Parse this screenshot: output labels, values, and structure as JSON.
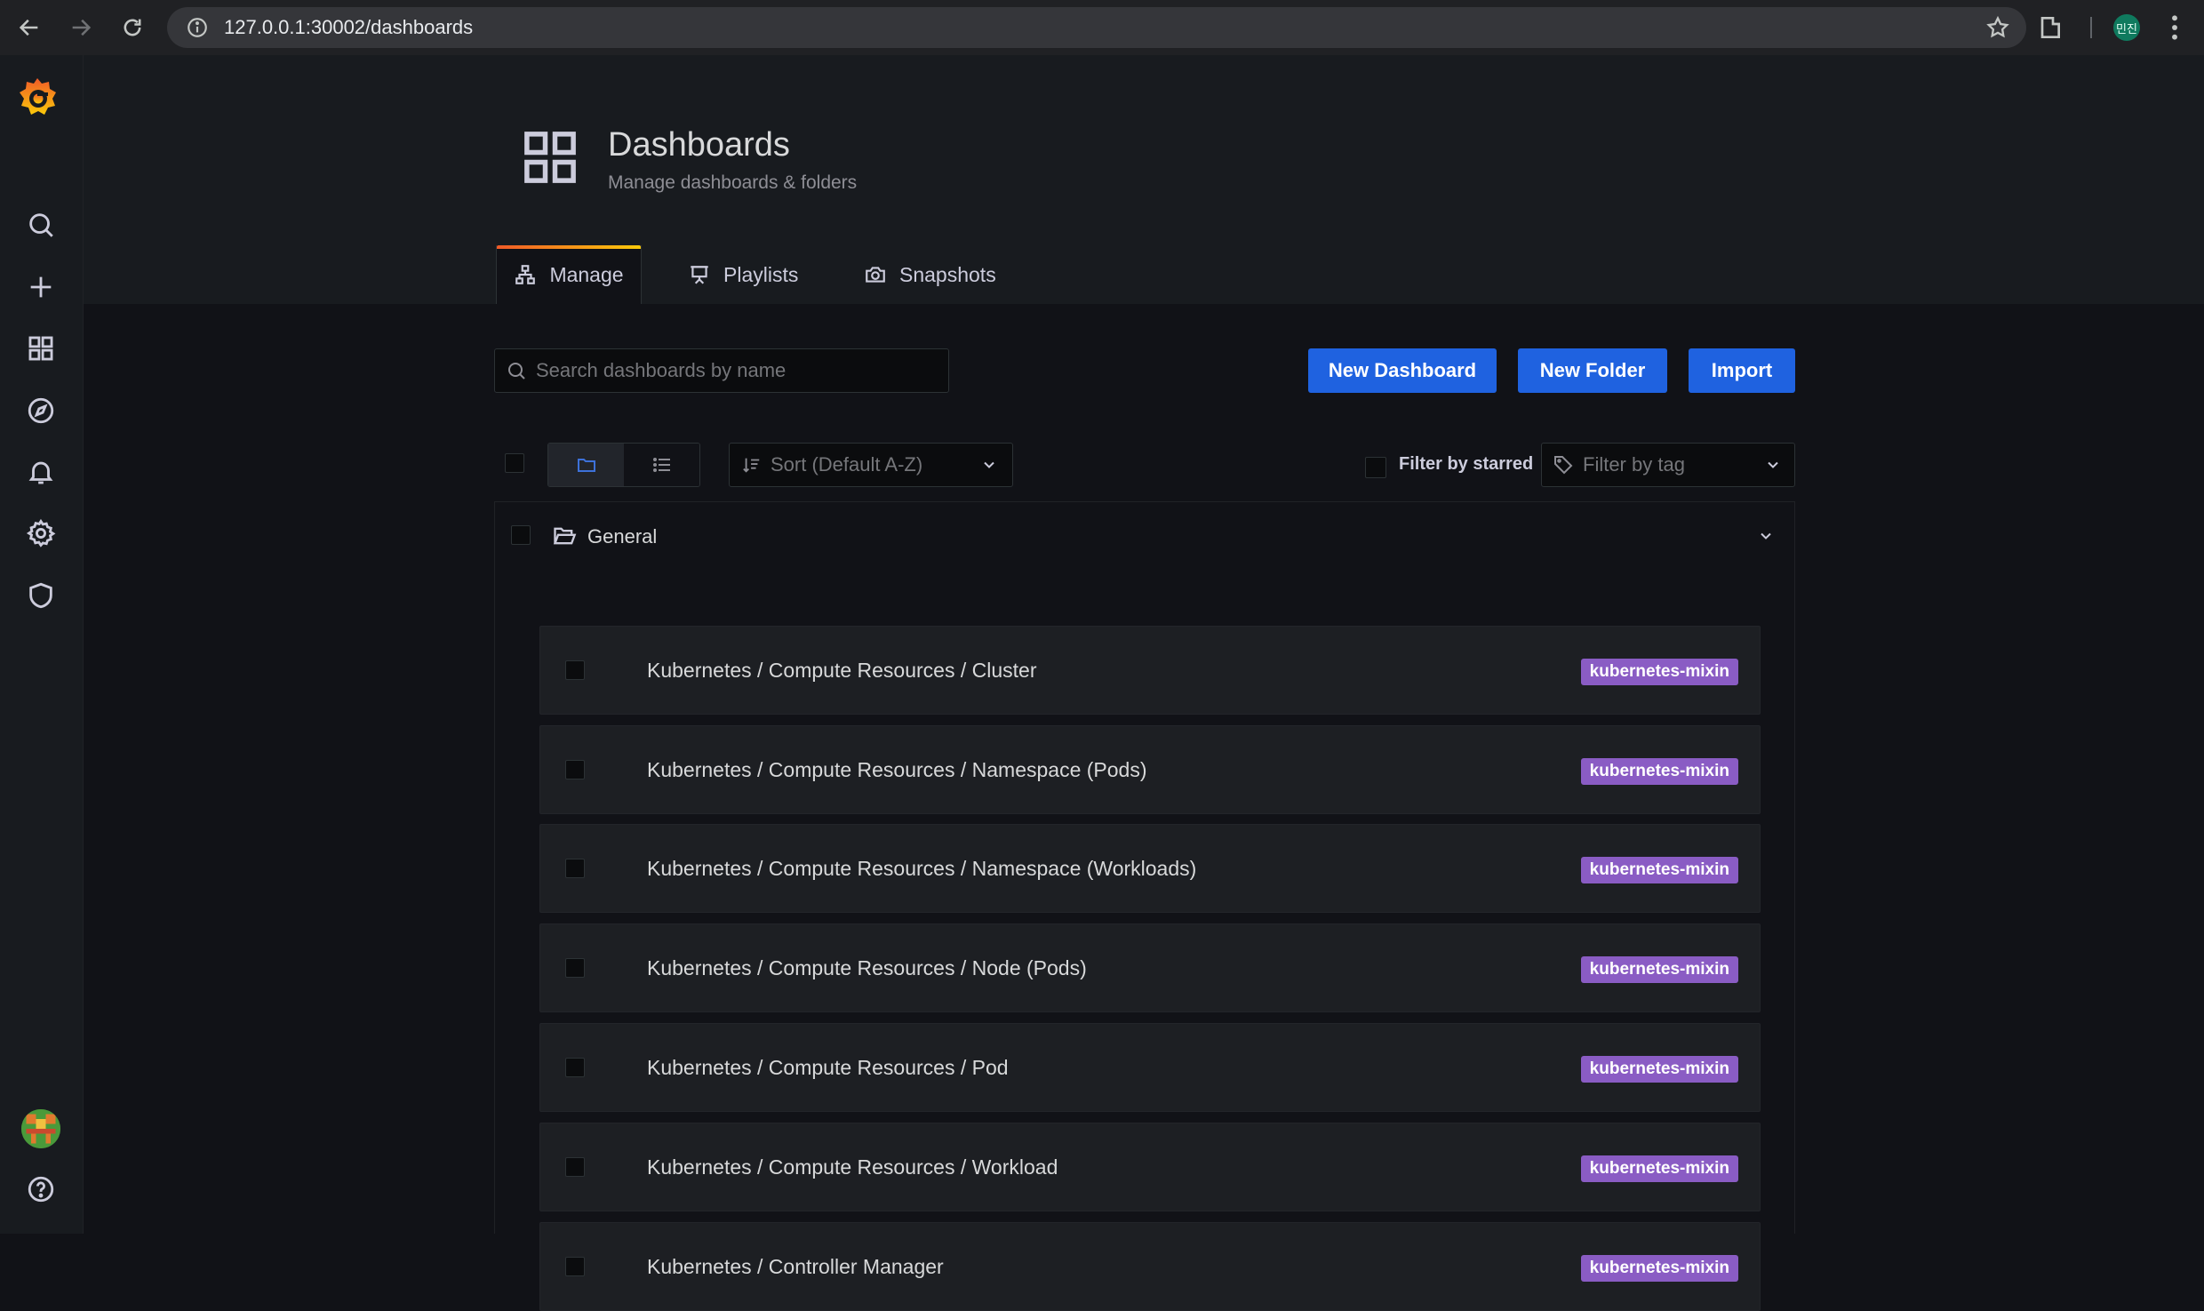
{
  "browser": {
    "url": "127.0.0.1:30002/dashboards",
    "profile_initials": "민진"
  },
  "page": {
    "title": "Dashboards",
    "subtitle": "Manage dashboards & folders"
  },
  "tabs": [
    {
      "label": "Manage",
      "icon": "sitemap-icon",
      "active": true
    },
    {
      "label": "Playlists",
      "icon": "presentation-icon",
      "active": false
    },
    {
      "label": "Snapshots",
      "icon": "camera-icon",
      "active": false
    }
  ],
  "search": {
    "placeholder": "Search dashboards by name",
    "value": ""
  },
  "actions": {
    "new_dashboard": "New Dashboard",
    "new_folder": "New Folder",
    "import": "Import"
  },
  "filters": {
    "sort_placeholder": "Sort (Default A-Z)",
    "starred_label": "Filter by starred",
    "tag_placeholder": "Filter by tag"
  },
  "folder": {
    "name": "General",
    "dashboards": [
      {
        "title": "Kubernetes / Compute Resources / Cluster",
        "tag": "kubernetes-mixin"
      },
      {
        "title": "Kubernetes / Compute Resources / Namespace (Pods)",
        "tag": "kubernetes-mixin"
      },
      {
        "title": "Kubernetes / Compute Resources / Namespace (Workloads)",
        "tag": "kubernetes-mixin"
      },
      {
        "title": "Kubernetes / Compute Resources / Node (Pods)",
        "tag": "kubernetes-mixin"
      },
      {
        "title": "Kubernetes / Compute Resources / Pod",
        "tag": "kubernetes-mixin"
      },
      {
        "title": "Kubernetes / Compute Resources / Workload",
        "tag": "kubernetes-mixin"
      },
      {
        "title": "Kubernetes / Controller Manager",
        "tag": "kubernetes-mixin"
      }
    ]
  },
  "colors": {
    "primary_button": "#1f62e0",
    "tag": "#8a5cc4",
    "tab_accent_start": "#f05a28",
    "tab_accent_end": "#fbca0a",
    "background": "#111217"
  }
}
